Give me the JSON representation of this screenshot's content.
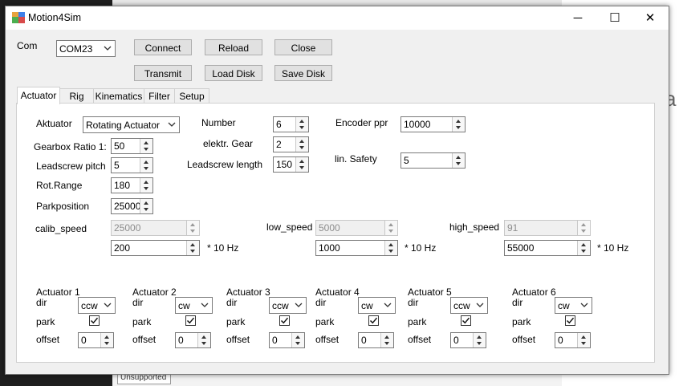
{
  "window": {
    "title": "Motion4Sim"
  },
  "titlebar": {
    "minimize": "─",
    "maximize": "☐",
    "close": "✕"
  },
  "com": {
    "label": "Com",
    "value": "COM23"
  },
  "buttons": {
    "connect": "Connect",
    "reload": "Reload",
    "close": "Close",
    "transmit": "Transmit",
    "load_disk": "Load Disk",
    "save_disk": "Save Disk"
  },
  "tabs": [
    "Actuator",
    "Rig",
    "Kinematics",
    "Filter",
    "Setup"
  ],
  "actuator": {
    "type_label": "Aktuator",
    "type_value": "Rotating Actuator",
    "number_label": "Number",
    "number_value": "6",
    "encoder_label": "Encoder ppr",
    "encoder_value": "10000",
    "gearbox_label": "Gearbox Ratio 1:",
    "gearbox_value": "50",
    "elektr_gear_label": "elektr. Gear",
    "elektr_gear_value": "2",
    "leadscrew_pitch_label": "Leadscrew pitch",
    "leadscrew_pitch_value": "5",
    "leadscrew_length_label": "Leadscrew length",
    "leadscrew_length_value": "150",
    "lin_safety_label": "lin. Safety",
    "lin_safety_value": "5",
    "rot_range_label": "Rot.Range",
    "rot_range_value": "180",
    "parkposition_label": "Parkposition",
    "parkposition_value": "25000"
  },
  "speeds": {
    "calib_label": "calib_speed",
    "calib_readonly": "25000",
    "calib_value": "200",
    "low_label": "low_speed",
    "low_readonly": "5000",
    "low_value": "1000",
    "high_label": "high_speed",
    "high_readonly": "91",
    "high_value": "55000",
    "unit": "* 10 Hz"
  },
  "actuators": [
    {
      "name": "Actuator 1",
      "dir": "ccw",
      "offset": "0"
    },
    {
      "name": "Actuator 2",
      "dir": "cw",
      "offset": "0"
    },
    {
      "name": "Actuator 3",
      "dir": "ccw",
      "offset": "0"
    },
    {
      "name": "Actuator 4",
      "dir": "cw",
      "offset": "0"
    },
    {
      "name": "Actuator 5",
      "dir": "ccw",
      "offset": "0"
    },
    {
      "name": "Actuator 6",
      "dir": "cw",
      "offset": "0"
    }
  ],
  "actuator_labels": {
    "dir": "dir",
    "park": "park",
    "offset": "offset"
  },
  "background": {
    "unsupported_tag": "Unsupported",
    "right_text": "a"
  }
}
